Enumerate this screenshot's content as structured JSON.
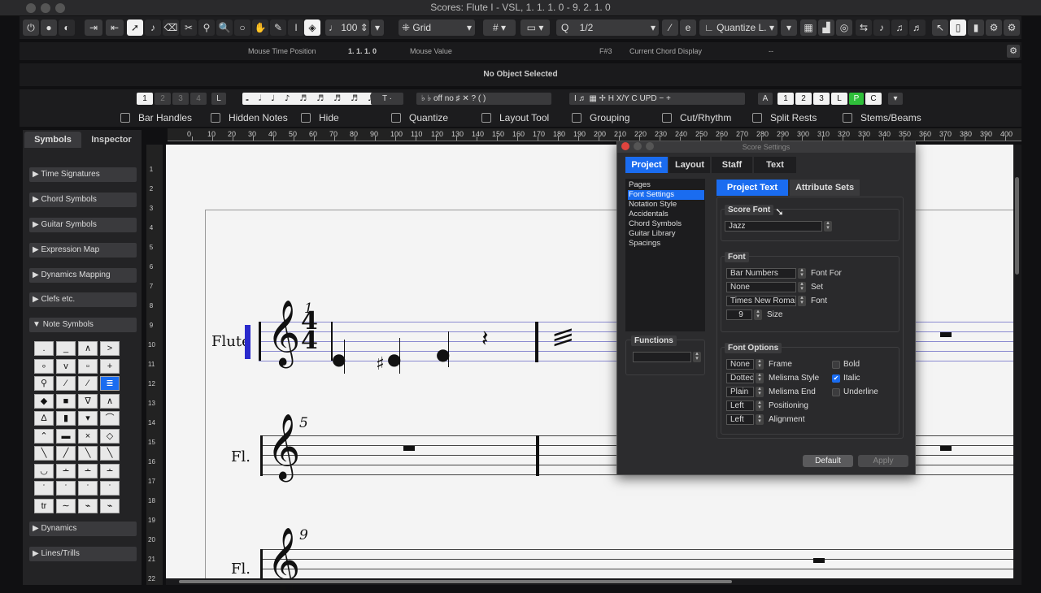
{
  "window": {
    "title": "Scores: Flute I - VSL, 1. 1. 1.  0 - 9. 2. 1.  0"
  },
  "toolbar": {
    "zoom_value": "100",
    "grid_label": "Grid",
    "quantize_value": "1/2",
    "quantize_mode": "Quantize L."
  },
  "infobar": {
    "mouse_time_label": "Mouse Time Position",
    "mouse_time_value": "1.  1.  1.    0",
    "mouse_value_label": "Mouse Value",
    "mouse_value": "F#3",
    "chord_label": "Current Chord Display",
    "chord_value": "--"
  },
  "status": {
    "text": "No Object Selected"
  },
  "symbolbar": {
    "pages": [
      "1",
      "2",
      "3",
      "4"
    ],
    "l_label": "L",
    "voices": [
      "1",
      "2",
      "3",
      "L",
      "P",
      "C"
    ],
    "a_label": "A",
    "specials": [
      "off",
      "no",
      "X/Y",
      "UPD"
    ]
  },
  "filters": [
    "Bar Handles",
    "Hidden Notes",
    "Hide",
    "Quantize",
    "Layout Tool",
    "Grouping",
    "Cut/Rhythm",
    "Split Rests",
    "Stems/Beams"
  ],
  "ruler": [
    "0",
    "10",
    "20",
    "30",
    "40",
    "50",
    "60",
    "70",
    "80",
    "90",
    "100",
    "110",
    "120",
    "130",
    "140",
    "150",
    "160",
    "170",
    "180",
    "190",
    "200",
    "210",
    "220",
    "230",
    "240",
    "250",
    "260",
    "270",
    "280",
    "290",
    "300",
    "310",
    "320",
    "330",
    "340",
    "350",
    "360",
    "370",
    "380",
    "390",
    "400"
  ],
  "vruler": [
    "1",
    "2",
    "3",
    "4",
    "5",
    "6",
    "7",
    "8",
    "9",
    "10",
    "11",
    "12",
    "13",
    "14",
    "15",
    "16",
    "17",
    "18",
    "19",
    "20",
    "21",
    "22"
  ],
  "leftpanel": {
    "tabs": [
      "Symbols",
      "Inspector"
    ],
    "categories": [
      "Time Signatures",
      "Chord Symbols",
      "Guitar Symbols",
      "Expression Map",
      "Dynamics Mapping",
      "Clefs etc.",
      "Note Symbols"
    ],
    "bottom_categories": [
      "Dynamics",
      "Lines/Trills"
    ]
  },
  "score": {
    "instrument_full": "Flute",
    "instrument_short": "Fl.",
    "bar_numbers": [
      "1",
      "5",
      "9"
    ]
  },
  "dialog": {
    "title": "Score Settings",
    "tabs": [
      "Project",
      "Layout",
      "Staff",
      "Text"
    ],
    "pages": [
      "Pages",
      "Font Settings",
      "Notation Style",
      "Accidentals",
      "Chord Symbols",
      "Guitar Library",
      "Spacings"
    ],
    "functions_label": "Functions",
    "subtabs": [
      "Project Text",
      "Attribute Sets"
    ],
    "score_font_label": "Score Font",
    "score_font_value": "Jazz",
    "font_label": "Font",
    "font_rows": [
      {
        "value": "Bar Numbers",
        "label": "Font For"
      },
      {
        "value": "None",
        "label": "Set"
      },
      {
        "value": "Times New Roman",
        "label": "Font"
      },
      {
        "value": "9",
        "label": "Size"
      }
    ],
    "font_options_label": "Font Options",
    "options": [
      {
        "value": "None",
        "label": "Frame"
      },
      {
        "value": "Dotted",
        "label": "Melisma Style"
      },
      {
        "value": "Plain",
        "label": "Melisma End"
      },
      {
        "value": "Left",
        "label": "Positioning"
      },
      {
        "value": "Left",
        "label": "Alignment"
      }
    ],
    "checks": [
      {
        "label": "Bold",
        "checked": false
      },
      {
        "label": "Italic",
        "checked": true
      },
      {
        "label": "Underline",
        "checked": false
      }
    ],
    "default_button": "Default",
    "apply_button": "Apply"
  }
}
